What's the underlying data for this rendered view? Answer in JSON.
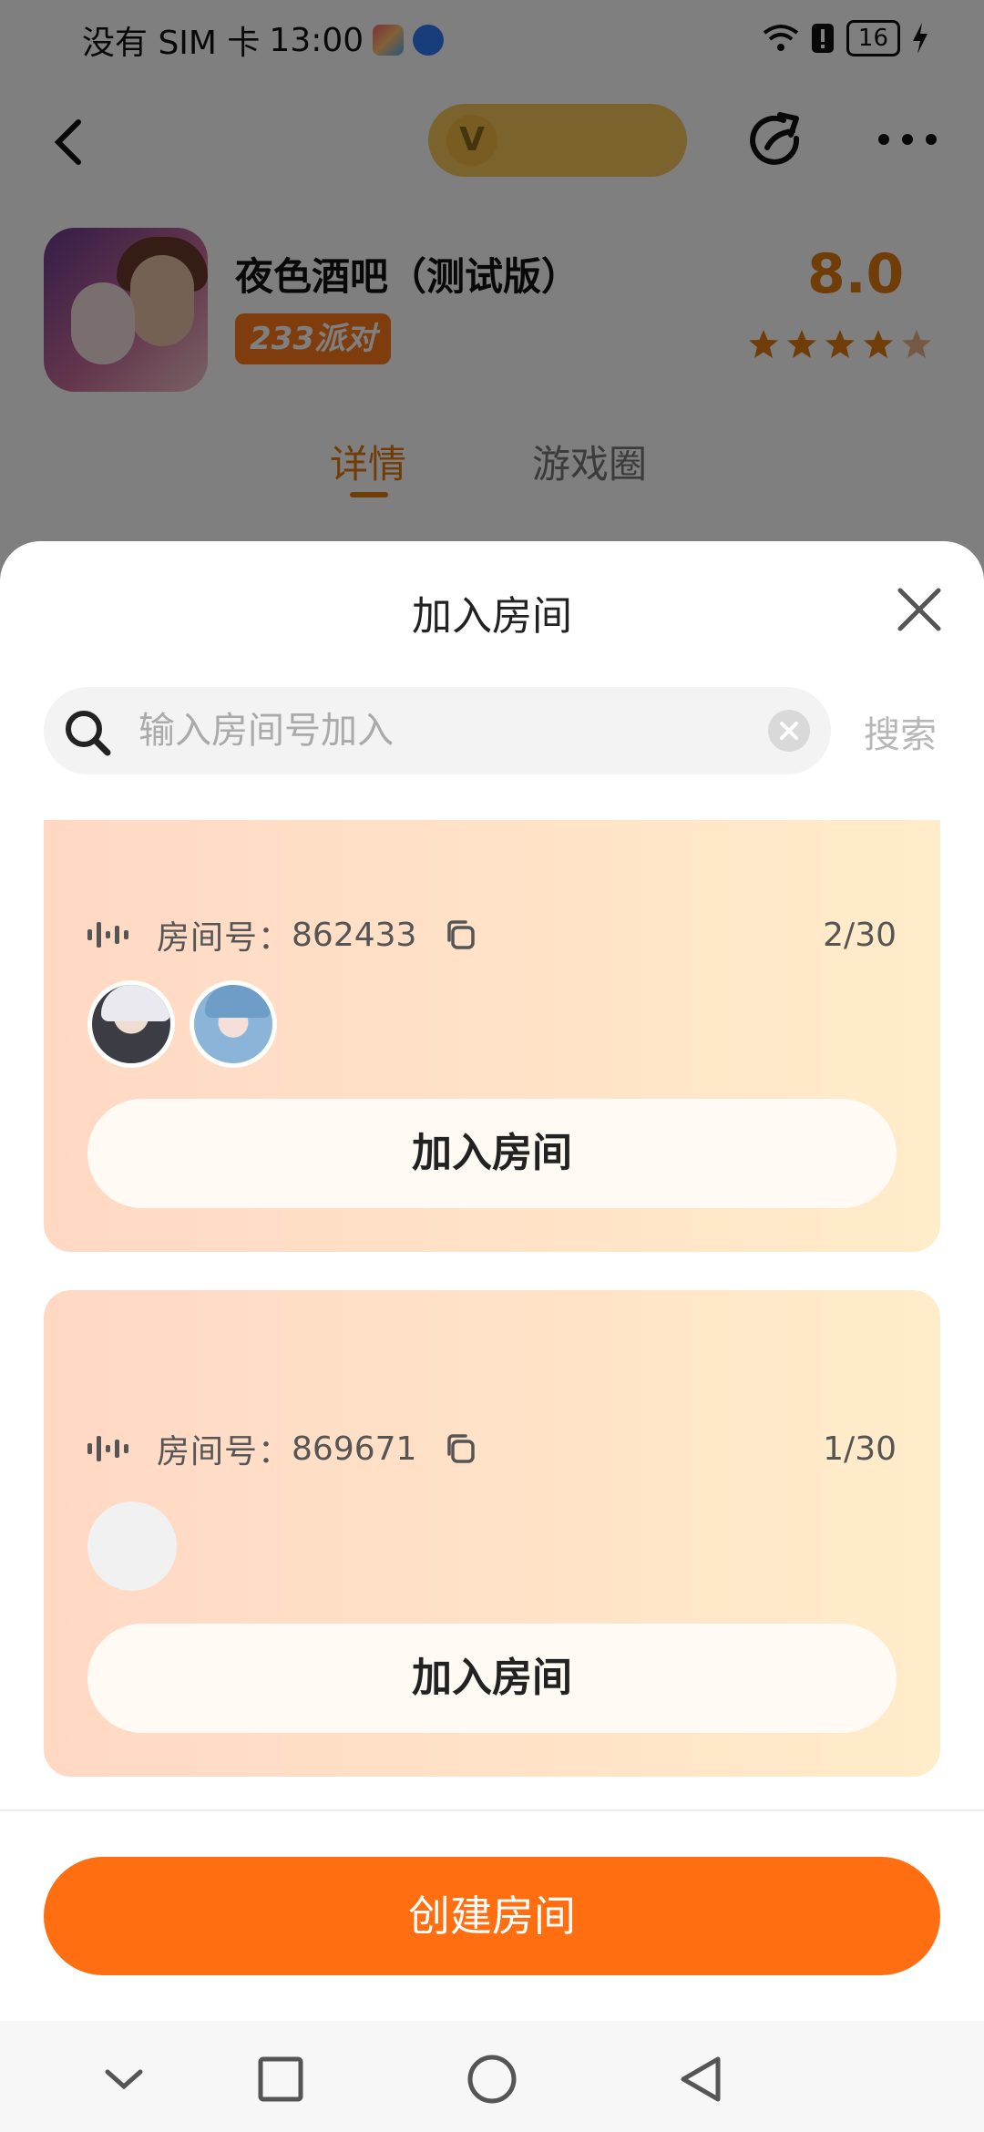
{
  "status_bar": {
    "carrier": "没有 SIM 卡",
    "time": "13:00",
    "battery": "16"
  },
  "app": {
    "title": "夜色酒吧（测试版）",
    "badge": "233派对",
    "rating": "8.0",
    "stars_filled": 4.5,
    "tabs": [
      "详情",
      "游戏圈"
    ]
  },
  "sheet": {
    "title": "加入房间",
    "search": {
      "placeholder": "输入房间号加入",
      "value": "",
      "button": "搜索"
    },
    "rooms": [
      {
        "label": "房间号：",
        "room_id": "862433",
        "count": "2/30",
        "join_label": "加入房间",
        "avatars": 2
      },
      {
        "label": "房间号：",
        "room_id": "869671",
        "count": "1/30",
        "join_label": "加入房间",
        "avatars": 0
      }
    ],
    "create_label": "创建房间"
  },
  "colors": {
    "accent": "#ff6f12",
    "rating": "#e0780f",
    "card_gradient_start": "#ffd8c4",
    "card_gradient_end": "#ffecca"
  },
  "icons": {
    "back": "back-icon",
    "share": "share-icon",
    "more": "more-icon",
    "close": "close-icon",
    "search": "search-icon",
    "clear": "clear-icon",
    "voice": "voice-icon",
    "copy": "copy-icon"
  }
}
